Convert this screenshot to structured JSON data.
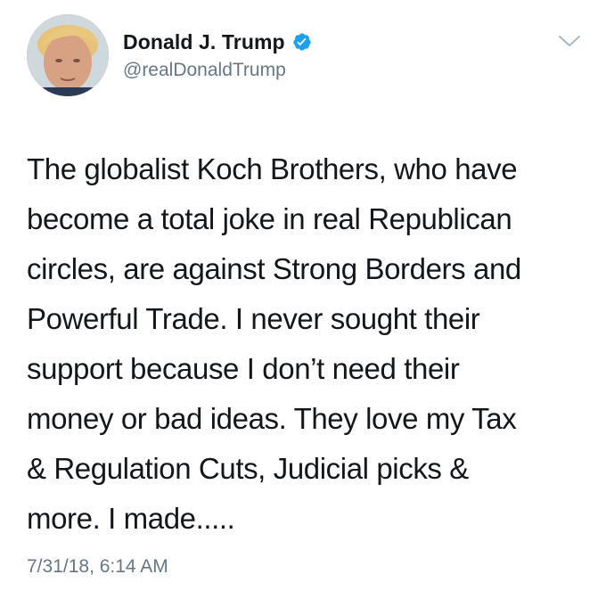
{
  "author": {
    "display_name": "Donald J. Trump",
    "handle": "@realDonaldTrump",
    "verified": true,
    "verified_color": "#1da1f2"
  },
  "tweet": {
    "lines": [
      "The globalist Koch Brothers, who have",
      "become a total joke in real Republican",
      "circles, are against Strong Borders and",
      "Powerful Trade. I never sought their",
      "support because I don’t need their",
      "money or bad ideas. They love my Tax",
      "& Regulation Cuts, Judicial picks &",
      "more. I made....."
    ],
    "timestamp": "7/31/18, 6:14 AM"
  },
  "icons": {
    "verified": "verified-badge-icon",
    "menu": "chevron-down-icon"
  }
}
